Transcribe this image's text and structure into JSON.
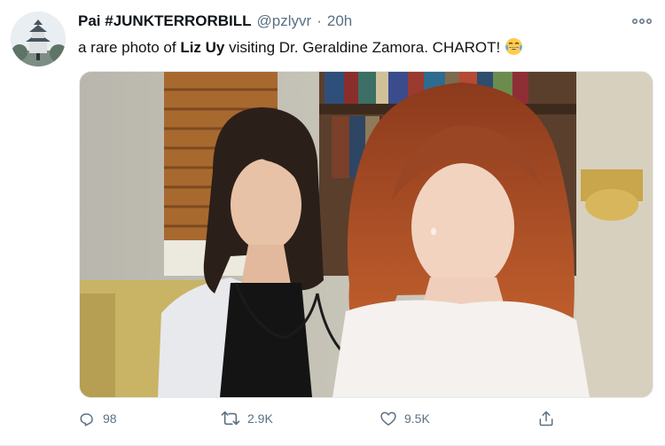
{
  "author": {
    "name": "Pai #JUNKTERRORBILL",
    "handle": "@pzlyvr",
    "separator": "·",
    "time": "20h"
  },
  "tweet": {
    "text_before": "a rare photo of ",
    "bold_name": "Liz Uy",
    "text_after": " visiting Dr. Geraldine Zamora. CHAROT! ",
    "emoji": "tears-of-joy-emoji"
  },
  "actions": {
    "reply_count": "98",
    "retweet_count": "2.9K",
    "like_count": "9.5K"
  },
  "icons": {
    "more": "more-horizontal-icon",
    "reply": "reply-icon",
    "retweet": "retweet-icon",
    "like": "heart-icon",
    "share": "share-icon"
  },
  "colors": {
    "text": "#0f1419",
    "secondary": "#5b7083",
    "divider": "#e6ecf0"
  }
}
